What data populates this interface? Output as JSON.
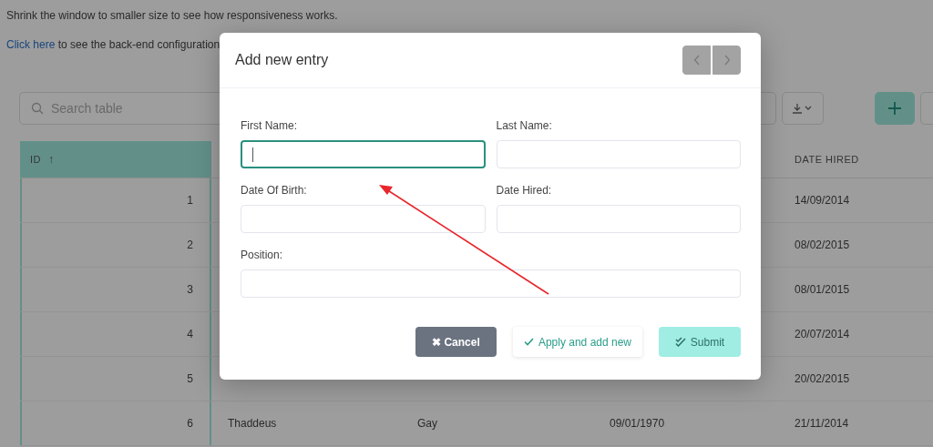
{
  "intro_text": "Shrink the window to smaller size to see how responsiveness works.",
  "config_line": {
    "link": "Click here",
    "text": "to see the back-end configuration"
  },
  "toolbar": {
    "search": {
      "placeholder": "Search table"
    },
    "buttons": [
      {
        "kind": "partial"
      },
      {
        "kind": "download"
      },
      {
        "kind": "add"
      },
      {
        "kind": "partial"
      }
    ]
  },
  "table": {
    "columns": [
      {
        "label": "ID",
        "sort_icon": "↑",
        "selected": true
      },
      {
        "label": "DATE HIRED",
        "selected": false
      }
    ],
    "rows": [
      {
        "id": "1",
        "date_hired": "14/09/2014"
      },
      {
        "id": "2",
        "date_hired": "08/02/2015"
      },
      {
        "id": "3",
        "date_hired": "08/01/2015"
      },
      {
        "id": "4",
        "date_hired": "20/07/2014"
      },
      {
        "id": "5",
        "date_hired": "20/02/2015"
      },
      {
        "id": "6",
        "first_name": "Thaddeus",
        "last_name": "Gay",
        "date_of_birth": "09/01/1970",
        "date_hired": "21/11/2014"
      }
    ]
  },
  "dialog": {
    "title": "Add new entry",
    "nav": [
      {
        "kind": "prev",
        "disabled": true
      },
      {
        "kind": "next",
        "disabled": true
      }
    ],
    "fields": [
      {
        "label": "First Name:",
        "focused": true,
        "wide": false
      },
      {
        "label": "Last Name:",
        "focused": false,
        "wide": false
      },
      {
        "label": "Date Of Birth:",
        "focused": false,
        "wide": false
      },
      {
        "label": "Date Hired:",
        "focused": false,
        "wide": false
      },
      {
        "label": "Position:",
        "focused": false,
        "wide": true
      }
    ],
    "buttons": [
      {
        "kind": "cancel",
        "label": "Cancel",
        "icon": "✖"
      },
      {
        "kind": "apply",
        "label": "Apply and add new"
      },
      {
        "kind": "submit",
        "label": "Submit"
      }
    ]
  }
}
